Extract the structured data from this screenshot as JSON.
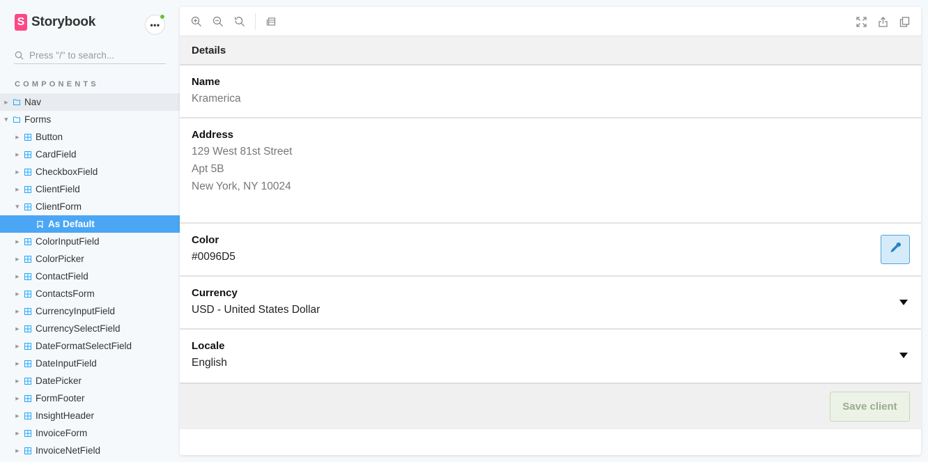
{
  "brand": {
    "logo_letter": "S",
    "name": "Storybook"
  },
  "menu": {
    "label": "•••",
    "status_color": "#66bf3c"
  },
  "search": {
    "placeholder": "Press \"/\" to search..."
  },
  "sidebar": {
    "section_title": "COMPONENTS",
    "items": [
      {
        "label": "Nav",
        "level": 0,
        "kind": "folder",
        "expanded": false,
        "state": "hover"
      },
      {
        "label": "Forms",
        "level": 0,
        "kind": "folder",
        "expanded": true,
        "state": ""
      },
      {
        "label": "Button",
        "level": 1,
        "kind": "component",
        "expanded": false,
        "state": ""
      },
      {
        "label": "CardField",
        "level": 1,
        "kind": "component",
        "expanded": false,
        "state": ""
      },
      {
        "label": "CheckboxField",
        "level": 1,
        "kind": "component",
        "expanded": false,
        "state": ""
      },
      {
        "label": "ClientField",
        "level": 1,
        "kind": "component",
        "expanded": false,
        "state": ""
      },
      {
        "label": "ClientForm",
        "level": 1,
        "kind": "component",
        "expanded": true,
        "state": ""
      },
      {
        "label": "As Default",
        "level": 2,
        "kind": "story",
        "expanded": false,
        "state": "selected"
      },
      {
        "label": "ColorInputField",
        "level": 1,
        "kind": "component",
        "expanded": false,
        "state": ""
      },
      {
        "label": "ColorPicker",
        "level": 1,
        "kind": "component",
        "expanded": false,
        "state": ""
      },
      {
        "label": "ContactField",
        "level": 1,
        "kind": "component",
        "expanded": false,
        "state": ""
      },
      {
        "label": "ContactsForm",
        "level": 1,
        "kind": "component",
        "expanded": false,
        "state": ""
      },
      {
        "label": "CurrencyInputField",
        "level": 1,
        "kind": "component",
        "expanded": false,
        "state": ""
      },
      {
        "label": "CurrencySelectField",
        "level": 1,
        "kind": "component",
        "expanded": false,
        "state": ""
      },
      {
        "label": "DateFormatSelectField",
        "level": 1,
        "kind": "component",
        "expanded": false,
        "state": ""
      },
      {
        "label": "DateInputField",
        "level": 1,
        "kind": "component",
        "expanded": false,
        "state": ""
      },
      {
        "label": "DatePicker",
        "level": 1,
        "kind": "component",
        "expanded": false,
        "state": ""
      },
      {
        "label": "FormFooter",
        "level": 1,
        "kind": "component",
        "expanded": false,
        "state": ""
      },
      {
        "label": "InsightHeader",
        "level": 1,
        "kind": "component",
        "expanded": false,
        "state": ""
      },
      {
        "label": "InvoiceForm",
        "level": 1,
        "kind": "component",
        "expanded": false,
        "state": ""
      },
      {
        "label": "InvoiceNetField",
        "level": 1,
        "kind": "component",
        "expanded": false,
        "state": ""
      }
    ]
  },
  "toolbar": {
    "left_icons": [
      "zoom-in-icon",
      "zoom-out-icon",
      "zoom-reset-icon",
      "background-icon"
    ],
    "right_icons": [
      "fullscreen-icon",
      "share-icon",
      "copy-icon"
    ]
  },
  "form": {
    "header": "Details",
    "name": {
      "label": "Name",
      "value": "Kramerica"
    },
    "address": {
      "label": "Address",
      "line1": "129 West 81st Street",
      "line2": "Apt 5B",
      "line3": "New York, NY 10024"
    },
    "color": {
      "label": "Color",
      "value": "#0096D5",
      "picker_icon": "eyedropper-icon"
    },
    "currency": {
      "label": "Currency",
      "value": "USD - United States Dollar"
    },
    "locale": {
      "label": "Locale",
      "value": "English"
    },
    "save_label": "Save client"
  },
  "colors": {
    "accent": "#4ba6f5",
    "brand": "#ff4785",
    "save_bg": "#ecf3e6"
  }
}
